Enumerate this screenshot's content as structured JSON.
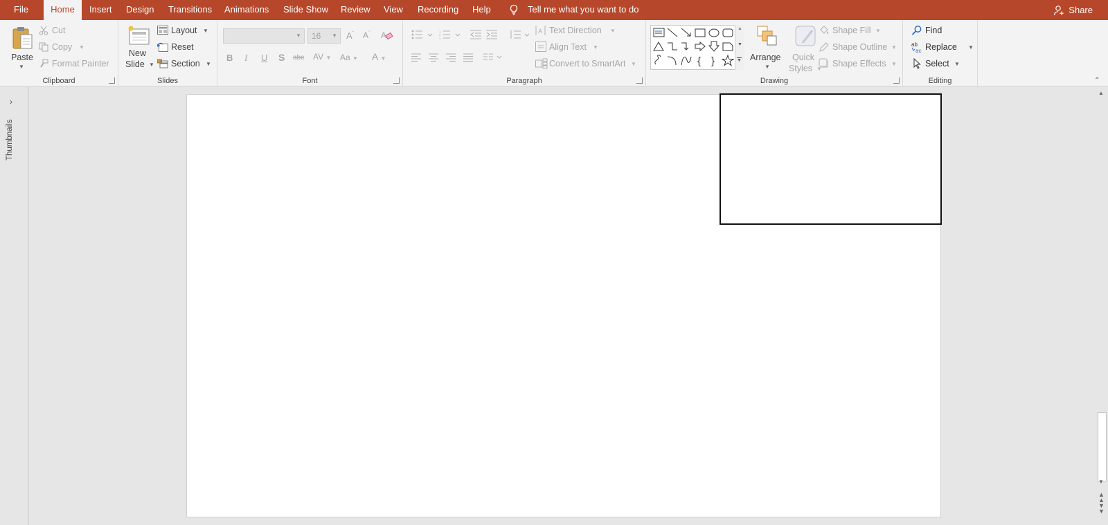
{
  "tabs": [
    {
      "label": "File",
      "active": false
    },
    {
      "label": "Home",
      "active": true
    },
    {
      "label": "Insert",
      "active": false
    },
    {
      "label": "Design",
      "active": false
    },
    {
      "label": "Transitions",
      "active": false
    },
    {
      "label": "Animations",
      "active": false
    },
    {
      "label": "Slide Show",
      "active": false
    },
    {
      "label": "Review",
      "active": false
    },
    {
      "label": "View",
      "active": false
    },
    {
      "label": "Recording",
      "active": false
    },
    {
      "label": "Help",
      "active": false
    }
  ],
  "tell_me": "Tell me what you want to do",
  "share": "Share",
  "clipboard": {
    "paste": "Paste",
    "cut": "Cut",
    "copy": "Copy",
    "format_painter": "Format Painter",
    "group_label": "Clipboard"
  },
  "slides": {
    "new_slide_line1": "New",
    "new_slide_line2": "Slide",
    "layout": "Layout",
    "reset": "Reset",
    "section": "Section",
    "group_label": "Slides"
  },
  "font": {
    "font_name": "",
    "font_size": "16",
    "bold": "B",
    "italic": "I",
    "underline": "U",
    "shadow": "S",
    "strikethrough": "abc",
    "spacing": "AV",
    "change_case": "Aa",
    "font_color": "A",
    "group_label": "Font"
  },
  "paragraph": {
    "text_direction": "Text Direction",
    "align_text": "Align Text",
    "convert_smartart": "Convert to SmartArt",
    "group_label": "Paragraph"
  },
  "drawing": {
    "arrange": "Arrange",
    "quick_styles_line1": "Quick",
    "quick_styles_line2": "Styles",
    "shape_fill": "Shape Fill",
    "shape_outline": "Shape Outline",
    "shape_effects": "Shape Effects",
    "group_label": "Drawing"
  },
  "editing": {
    "find": "Find",
    "replace": "Replace",
    "select": "Select",
    "group_label": "Editing"
  },
  "thumbnails_label": "Thumbnails",
  "colors": {
    "accent": "#b7472a",
    "ribbon_bg": "#f3f3f3",
    "workspace_bg": "#e6e6e6"
  }
}
